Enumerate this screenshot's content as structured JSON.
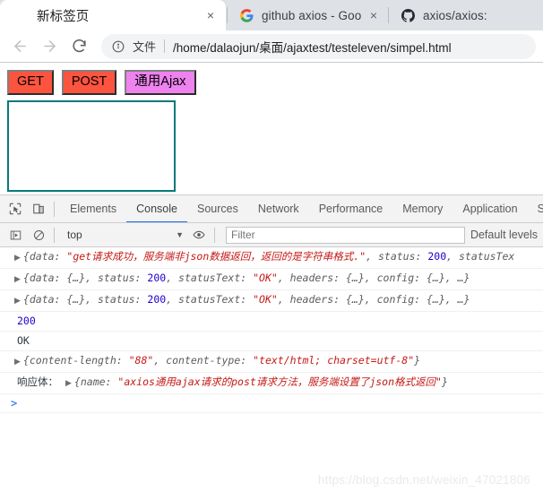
{
  "browser": {
    "tabs": [
      {
        "title": "新标签页",
        "favicon": "none",
        "active": true,
        "close_label": "×"
      },
      {
        "title": "github axios - Google Sear",
        "favicon": "google-icon",
        "active": false,
        "close_label": "×"
      },
      {
        "title": "axios/axios:",
        "favicon": "github-icon",
        "active": false,
        "close_label": ""
      }
    ],
    "toolbar": {
      "back_label": "←",
      "forward_label": "→",
      "reload_label": "⟳",
      "info_icon": "info-circle-icon",
      "scheme_label": "文件",
      "url": "/home/dalaojun/桌面/ajaxtest/testeleven/simpel.html"
    }
  },
  "page": {
    "buttons": [
      {
        "label": "GET",
        "color": "#fd5440",
        "style": "orange"
      },
      {
        "label": "POST",
        "color": "#fd5440",
        "style": "orange"
      },
      {
        "label": "通用Ajax",
        "color": "#ee82ee",
        "style": "violet"
      }
    ],
    "result_box": {
      "text": "",
      "border_color": "#07797d"
    }
  },
  "devtools": {
    "icons": [
      {
        "name": "inspect-element-icon"
      },
      {
        "name": "device-toolbar-icon"
      }
    ],
    "tabs": [
      {
        "label": "Elements",
        "selected": false
      },
      {
        "label": "Console",
        "selected": true
      },
      {
        "label": "Sources",
        "selected": false
      },
      {
        "label": "Network",
        "selected": false
      },
      {
        "label": "Performance",
        "selected": false
      },
      {
        "label": "Memory",
        "selected": false
      },
      {
        "label": "Application",
        "selected": false
      },
      {
        "label": "S",
        "selected": false
      }
    ],
    "console_toolbar": {
      "execute_icon": "execute-snippet-icon",
      "clear_icon": "clear-console-icon",
      "context": "top",
      "caret": "▼",
      "eye_icon": "live-expression-icon",
      "filter_value": "",
      "filter_placeholder": "Filter",
      "levels_label": "Default levels"
    },
    "log_rows": [
      {
        "type": "object",
        "expandable": true,
        "parts": [
          {
            "t": "{data: ",
            "c": "obj"
          },
          {
            "t": "\"get请求成功，服务端非json数据返回，返回的是字符串格式.\"",
            "c": "str"
          },
          {
            "t": ", status: ",
            "c": "obj"
          },
          {
            "t": "200",
            "c": "num"
          },
          {
            "t": ", statusTex",
            "c": "obj"
          }
        ]
      },
      {
        "type": "object",
        "expandable": true,
        "parts": [
          {
            "t": "{data: {…}, status: ",
            "c": "obj"
          },
          {
            "t": "200",
            "c": "num"
          },
          {
            "t": ", statusText: ",
            "c": "obj"
          },
          {
            "t": "\"OK\"",
            "c": "str"
          },
          {
            "t": ", headers: {…}, config: {…}, …}",
            "c": "obj"
          }
        ]
      },
      {
        "type": "object",
        "expandable": true,
        "parts": [
          {
            "t": "{data: {…}, status: ",
            "c": "obj"
          },
          {
            "t": "200",
            "c": "num"
          },
          {
            "t": ", statusText: ",
            "c": "obj"
          },
          {
            "t": "\"OK\"",
            "c": "str"
          },
          {
            "t": ", headers: {…}, config: {…}, …}",
            "c": "obj"
          }
        ]
      },
      {
        "type": "value",
        "expandable": false,
        "parts": [
          {
            "t": "200",
            "c": "num"
          }
        ]
      },
      {
        "type": "value",
        "expandable": false,
        "parts": [
          {
            "t": "OK",
            "c": "plain"
          }
        ]
      },
      {
        "type": "object",
        "expandable": true,
        "parts": [
          {
            "t": "{content-length: ",
            "c": "obj"
          },
          {
            "t": "\"88\"",
            "c": "str"
          },
          {
            "t": ", content-type: ",
            "c": "obj"
          },
          {
            "t": "\"text/html; charset=utf-8\"",
            "c": "str"
          },
          {
            "t": "}",
            "c": "obj"
          }
        ]
      },
      {
        "type": "labeled-object",
        "expandable": true,
        "label": "响应体：",
        "parts": [
          {
            "t": "{name: ",
            "c": "obj"
          },
          {
            "t": "\"axios通用ajax请求的post请求方法，服务端设置了json格式返回\"",
            "c": "str"
          },
          {
            "t": "}",
            "c": "obj"
          }
        ]
      }
    ],
    "prompt": {
      "caret": "❯"
    }
  },
  "watermark": {
    "text": "https://blog.csdn.net/weixin_47021806"
  }
}
